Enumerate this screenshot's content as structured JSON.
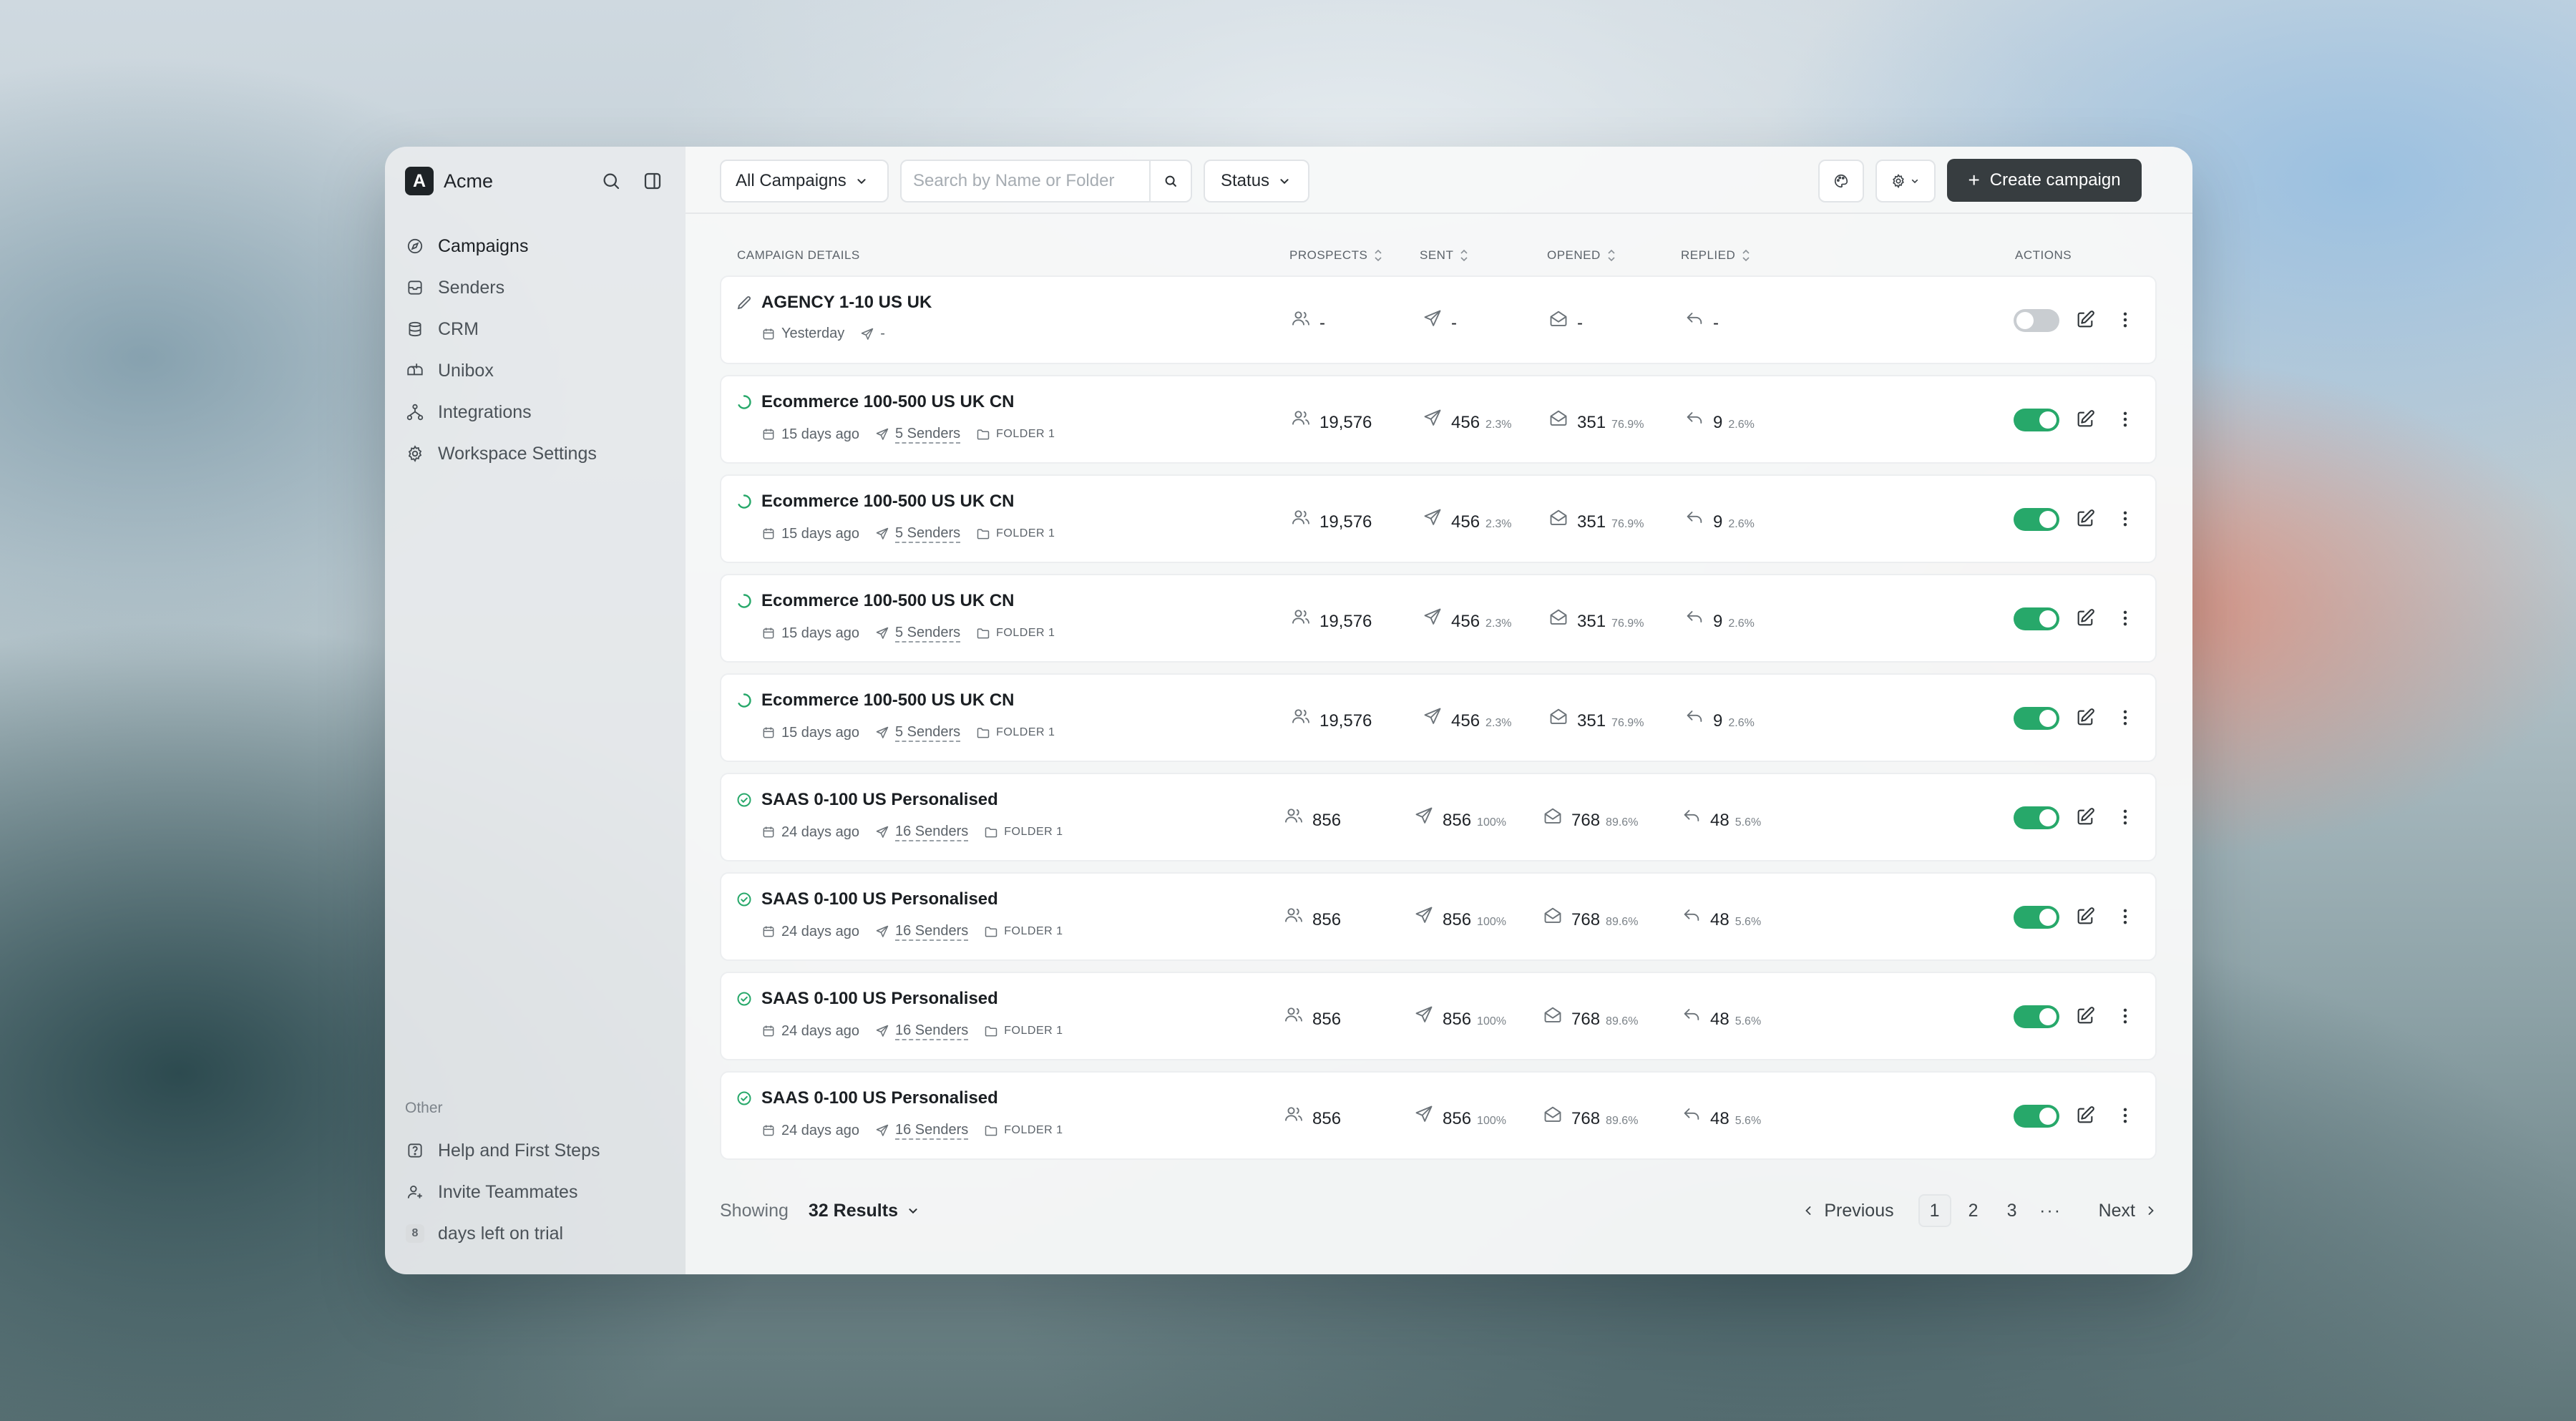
{
  "app": {
    "logo_letter": "A",
    "name": "Acme"
  },
  "sidebar": {
    "items": [
      {
        "label": "Campaigns",
        "icon": "compass-icon",
        "active": true
      },
      {
        "label": "Senders",
        "icon": "inbox-stack-icon"
      },
      {
        "label": "CRM",
        "icon": "database-icon"
      },
      {
        "label": "Unibox",
        "icon": "mailbox-icon"
      },
      {
        "label": "Integrations",
        "icon": "network-icon"
      },
      {
        "label": "Workspace Settings",
        "icon": "gear-icon"
      }
    ],
    "other_label": "Other",
    "bottom_items": [
      {
        "label": "Help and First Steps",
        "icon": "question-icon"
      },
      {
        "label": "Invite Teammates",
        "icon": "user-plus-icon"
      }
    ],
    "trial": {
      "days": "8",
      "label": "days left on trial"
    }
  },
  "toolbar": {
    "filter_label": "All Campaigns",
    "search_placeholder": "Search by Name or Folder",
    "status_label": "Status",
    "create_label": "Create campaign"
  },
  "table": {
    "headers": {
      "details": "CAMPAIGN DETAILS",
      "prospects": "PROSPECTS",
      "sent": "SENT",
      "opened": "OPENED",
      "replied": "REPLIED",
      "actions": "ACTIONS"
    },
    "rows": [
      {
        "status": "draft",
        "name": "AGENCY 1-10 US UK",
        "date": "Yesterday",
        "senders": "-",
        "folder": "",
        "prospects": "-",
        "sent": "-",
        "sent_pct": "",
        "opened": "-",
        "opened_pct": "",
        "replied": "-",
        "replied_pct": "",
        "enabled": false
      },
      {
        "status": "running",
        "name": "Ecommerce 100-500 US UK CN",
        "date": "15 days ago",
        "senders": "5 Senders",
        "folder": "FOLDER 1",
        "prospects": "19,576",
        "sent": "456",
        "sent_pct": "2.3%",
        "opened": "351",
        "opened_pct": "76.9%",
        "replied": "9",
        "replied_pct": "2.6%",
        "enabled": true
      },
      {
        "status": "running",
        "name": "Ecommerce 100-500 US UK CN",
        "date": "15 days ago",
        "senders": "5 Senders",
        "folder": "FOLDER 1",
        "prospects": "19,576",
        "sent": "456",
        "sent_pct": "2.3%",
        "opened": "351",
        "opened_pct": "76.9%",
        "replied": "9",
        "replied_pct": "2.6%",
        "enabled": true
      },
      {
        "status": "running",
        "name": "Ecommerce 100-500 US UK CN",
        "date": "15 days ago",
        "senders": "5 Senders",
        "folder": "FOLDER 1",
        "prospects": "19,576",
        "sent": "456",
        "sent_pct": "2.3%",
        "opened": "351",
        "opened_pct": "76.9%",
        "replied": "9",
        "replied_pct": "2.6%",
        "enabled": true
      },
      {
        "status": "running",
        "name": "Ecommerce 100-500 US UK CN",
        "date": "15 days ago",
        "senders": "5 Senders",
        "folder": "FOLDER 1",
        "prospects": "19,576",
        "sent": "456",
        "sent_pct": "2.3%",
        "opened": "351",
        "opened_pct": "76.9%",
        "replied": "9",
        "replied_pct": "2.6%",
        "enabled": true
      },
      {
        "status": "completed",
        "name": "SAAS 0-100 US Personalised",
        "date": "24 days ago",
        "senders": "16 Senders",
        "folder": "FOLDER 1",
        "prospects": "856",
        "sent": "856",
        "sent_pct": "100%",
        "opened": "768",
        "opened_pct": "89.6%",
        "replied": "48",
        "replied_pct": "5.6%",
        "enabled": true
      },
      {
        "status": "completed",
        "name": "SAAS 0-100 US Personalised",
        "date": "24 days ago",
        "senders": "16 Senders",
        "folder": "FOLDER 1",
        "prospects": "856",
        "sent": "856",
        "sent_pct": "100%",
        "opened": "768",
        "opened_pct": "89.6%",
        "replied": "48",
        "replied_pct": "5.6%",
        "enabled": true
      },
      {
        "status": "completed",
        "name": "SAAS 0-100 US Personalised",
        "date": "24 days ago",
        "senders": "16 Senders",
        "folder": "FOLDER 1",
        "prospects": "856",
        "sent": "856",
        "sent_pct": "100%",
        "opened": "768",
        "opened_pct": "89.6%",
        "replied": "48",
        "replied_pct": "5.6%",
        "enabled": true
      },
      {
        "status": "completed",
        "name": "SAAS 0-100 US Personalised",
        "date": "24 days ago",
        "senders": "16 Senders",
        "folder": "FOLDER 1",
        "prospects": "856",
        "sent": "856",
        "sent_pct": "100%",
        "opened": "768",
        "opened_pct": "89.6%",
        "replied": "48",
        "replied_pct": "5.6%",
        "enabled": true
      }
    ]
  },
  "footer": {
    "showing_label": "Showing",
    "results_label": "32 Results",
    "prev_label": "Previous",
    "pages": [
      "1",
      "2",
      "3"
    ],
    "current_page": "1",
    "ellipsis": "···",
    "next_label": "Next"
  },
  "colors": {
    "accent_green": "#27a86a",
    "primary_button": "#373d40",
    "toggle_off": "#c9cdd1"
  }
}
